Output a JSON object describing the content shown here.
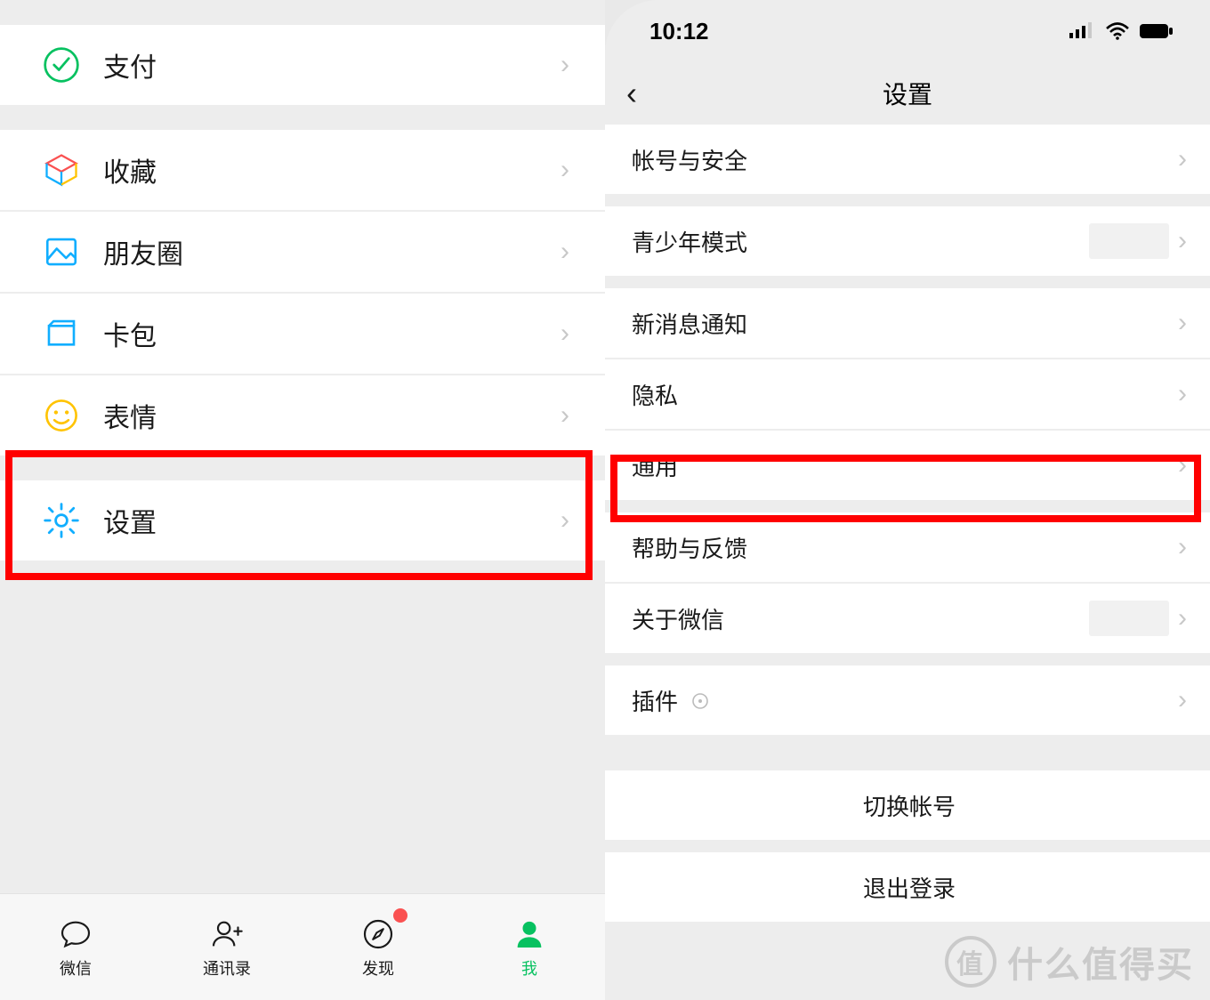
{
  "left": {
    "menu": [
      {
        "id": "pay",
        "label": "支付"
      },
      {
        "id": "fav",
        "label": "收藏"
      },
      {
        "id": "moments",
        "label": "朋友圈"
      },
      {
        "id": "cards",
        "label": "卡包"
      },
      {
        "id": "emoji",
        "label": "表情"
      },
      {
        "id": "settings",
        "label": "设置"
      }
    ],
    "tabs": [
      {
        "id": "chats",
        "label": "微信"
      },
      {
        "id": "contacts",
        "label": "通讯录"
      },
      {
        "id": "discover",
        "label": "发现"
      },
      {
        "id": "me",
        "label": "我"
      }
    ]
  },
  "right": {
    "status_time": "10:12",
    "nav_title": "设置",
    "rows": {
      "account": "帐号与安全",
      "youth": "青少年模式",
      "notif": "新消息通知",
      "privacy": "隐私",
      "general": "通用",
      "help": "帮助与反馈",
      "about": "关于微信",
      "plugin": "插件",
      "switch": "切换帐号",
      "logout": "退出登录"
    }
  },
  "watermark": {
    "badge": "值",
    "text": "什么值得买"
  }
}
